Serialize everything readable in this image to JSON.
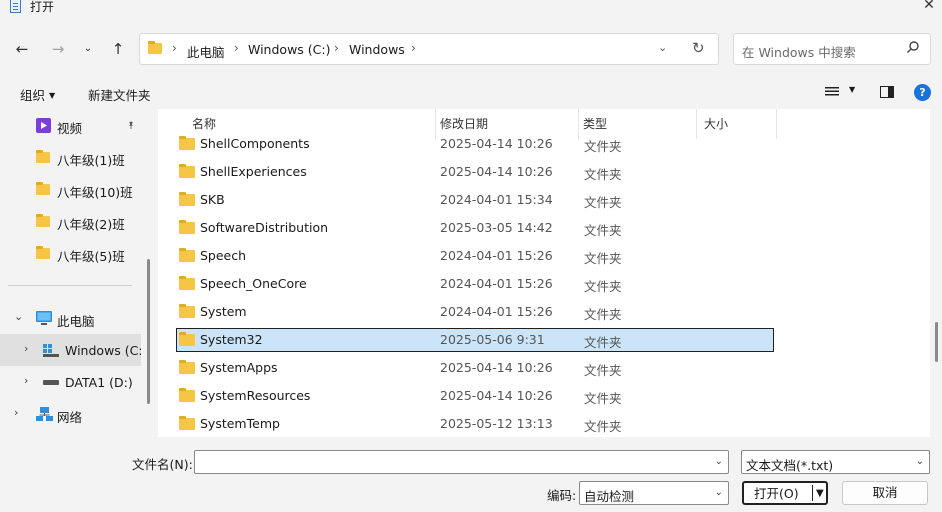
{
  "window": {
    "title": "打开"
  },
  "nav": {
    "breadcrumbs": [
      "此电脑",
      "Windows (C:)",
      "Windows"
    ],
    "search_placeholder": "在 Windows 中搜索"
  },
  "toolbar": {
    "organize": "组织",
    "new_folder": "新建文件夹"
  },
  "sidebar": {
    "quick": [
      {
        "label": "视频",
        "icon": "video-icon",
        "pinned": true
      },
      {
        "label": "八年级(1)班",
        "icon": "folder-icon"
      },
      {
        "label": "八年级(10)班",
        "icon": "folder-icon"
      },
      {
        "label": "八年级(2)班",
        "icon": "folder-icon"
      },
      {
        "label": "八年级(5)班",
        "icon": "folder-icon"
      }
    ],
    "tree": [
      {
        "label": "此电脑",
        "icon": "computer-icon",
        "expanded": true
      },
      {
        "label": "Windows (C:)",
        "icon": "windows-drive-icon",
        "selected": true
      },
      {
        "label": "DATA1 (D:)",
        "icon": "drive-icon"
      },
      {
        "label": "网络",
        "icon": "network-icon"
      }
    ]
  },
  "columns": {
    "name": "名称",
    "date": "修改日期",
    "type": "类型",
    "size": "大小"
  },
  "files": [
    {
      "name": "ShellComponents",
      "date": "2025-04-14 10:26",
      "type": "文件夹"
    },
    {
      "name": "ShellExperiences",
      "date": "2025-04-14 10:26",
      "type": "文件夹"
    },
    {
      "name": "SKB",
      "date": "2024-04-01 15:34",
      "type": "文件夹"
    },
    {
      "name": "SoftwareDistribution",
      "date": "2025-03-05 14:42",
      "type": "文件夹"
    },
    {
      "name": "Speech",
      "date": "2024-04-01 15:26",
      "type": "文件夹"
    },
    {
      "name": "Speech_OneCore",
      "date": "2024-04-01 15:26",
      "type": "文件夹"
    },
    {
      "name": "System",
      "date": "2024-04-01 15:26",
      "type": "文件夹"
    },
    {
      "name": "System32",
      "date": "2025-05-06 9:31",
      "type": "文件夹",
      "selected": true
    },
    {
      "name": "SystemApps",
      "date": "2025-04-14 10:26",
      "type": "文件夹"
    },
    {
      "name": "SystemResources",
      "date": "2025-04-14 10:26",
      "type": "文件夹"
    },
    {
      "name": "SystemTemp",
      "date": "2025-05-12 13:13",
      "type": "文件夹"
    }
  ],
  "footer": {
    "filename_label": "文件名(N):",
    "filename_value": "",
    "filetype": "文本文档(*.txt)",
    "encoding_label": "编码:",
    "encoding": "自动检测",
    "open_label": "打开(O)",
    "cancel_label": "取消"
  },
  "colors": {
    "accent": "#1a73d9",
    "selection": "#cce4f7",
    "folder": "#f6c544"
  }
}
